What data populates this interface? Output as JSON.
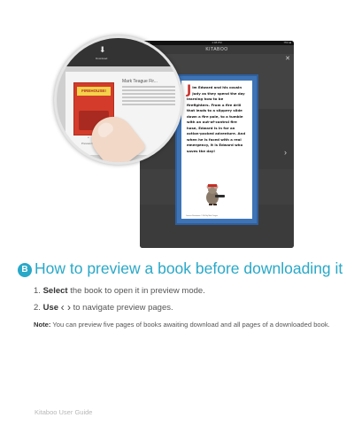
{
  "illustration": {
    "ipad": {
      "status_left": "iPad ≈",
      "time": "1:08 PM",
      "battery": "75% ■",
      "app_title": "KITABOO",
      "pager": "● ● ●"
    },
    "book_page": {
      "dropcap": "J",
      "text": "im Edward and his cousin Judy as they spend the day learning how to be firefighters. From a fire drill that leads to a slippery slide down a fire pole, to a tumble with an out-of-control fire hose, Edward is in for an action-packed adventure. And when he is faced with a real emergency, it is Edward who saves the day!",
      "credit": "Jasmine Illustrations © 2004 by Mark Teague"
    },
    "magnified": {
      "download_label": "Download",
      "book_title": "Mark Teague Fir...",
      "cover_banner": "FIREHOUSE!",
      "preview_label": "Preview Book",
      "dots": "● ● ● ●"
    }
  },
  "section": {
    "badge": "B",
    "title": "How to preview a book before downloading it"
  },
  "steps": [
    {
      "number": "1.",
      "keyword": "Select",
      "rest": " the book to open it in preview mode."
    },
    {
      "number": "2.",
      "keyword": "Use",
      "icons": "‹ ›",
      "rest": " to navigate preview pages."
    }
  ],
  "note": {
    "label": "Note:",
    "text": " You can preview five pages of books awaiting download and all pages of a downloaded book."
  },
  "footer": "Kitaboo User Guide"
}
